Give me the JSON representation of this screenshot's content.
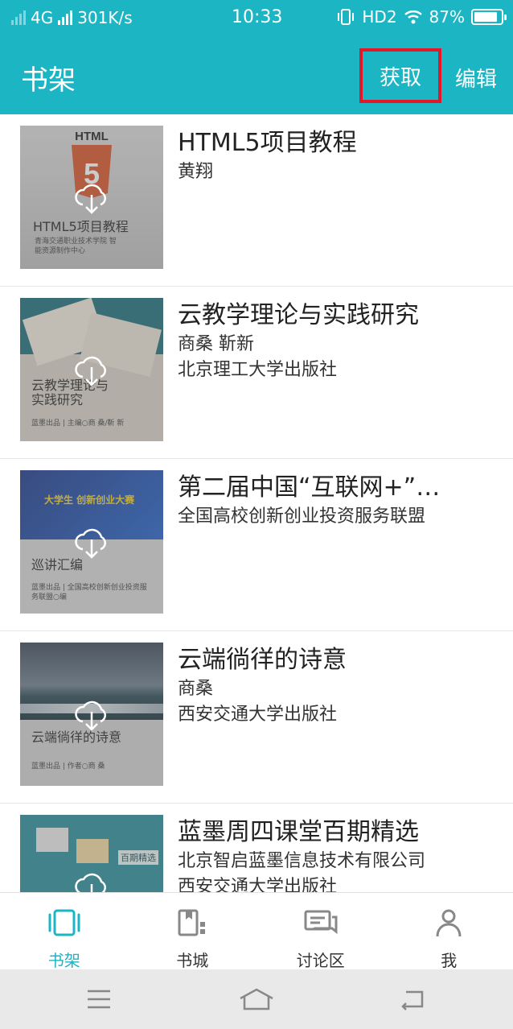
{
  "status": {
    "network": "4G",
    "speed": "301K/s",
    "time": "10:33",
    "hd": "HD2",
    "battery": "87%",
    "battery_level": 0.87
  },
  "header": {
    "title": "书架",
    "get_label": "获取",
    "edit_label": "编辑"
  },
  "colors": {
    "accent": "#1cb5c4",
    "highlight": "#e3162a"
  },
  "books": [
    {
      "title": "HTML5项目教程",
      "meta": [
        "黄翔"
      ],
      "cover_title": "HTML5项目教程",
      "cover_sub": "青海交通职业技术学院 智能资源制作中心",
      "cover_badge": "HTML",
      "icon": "download-cloud-icon"
    },
    {
      "title": "云教学理论与实践研究",
      "meta": [
        "商桑  靳新",
        "北京理工大学出版社"
      ],
      "cover_title": "云教学理论与实践研究",
      "cover_sub": "蓝墨出品 | 主编○商 桑/靳 新",
      "icon": "download-cloud-icon"
    },
    {
      "title": "第二届中国“互联网+”…",
      "meta": [
        "全国高校创新创业投资服务联盟"
      ],
      "cover_title": "巡讲汇编",
      "cover_sub": "蓝墨出品 | 全国高校创新创业投资服务联盟○编",
      "cover_banner": "大学生 创新创业大赛",
      "icon": "download-cloud-icon"
    },
    {
      "title": "云端徜徉的诗意",
      "meta": [
        "商桑",
        "西安交通大学出版社"
      ],
      "cover_title": "云端徜徉的诗意",
      "cover_sub": "蓝墨出品 | 作者○商 桑",
      "icon": "download-cloud-icon"
    },
    {
      "title": "蓝墨周四课堂百期精选",
      "meta": [
        "北京智启蓝墨信息技术有限公司",
        "西安交通大学出版社"
      ],
      "cover_title": "百期精选",
      "cover_sub": "",
      "icon": "download-cloud-icon"
    }
  ],
  "tabs": [
    {
      "label": "书架",
      "icon": "bookshelf-icon",
      "active": true
    },
    {
      "label": "书城",
      "icon": "bookstore-icon",
      "active": false
    },
    {
      "label": "讨论区",
      "icon": "discussion-icon",
      "active": false
    },
    {
      "label": "我",
      "icon": "profile-icon",
      "active": false
    }
  ],
  "navbar": {
    "buttons": [
      "menu-icon",
      "home-icon",
      "back-icon"
    ]
  }
}
